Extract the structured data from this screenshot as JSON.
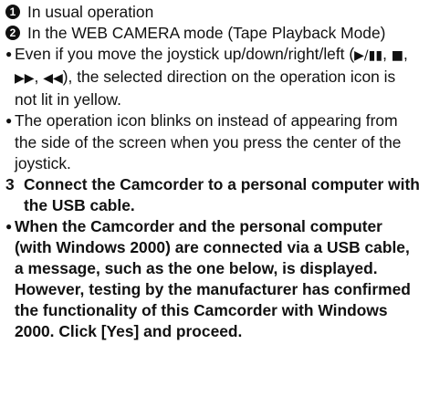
{
  "items": {
    "item1": {
      "marker": "1",
      "text": "In usual operation"
    },
    "item2": {
      "marker": "2",
      "text": "In the WEB CAMERA mode (Tape Playback Mode)"
    }
  },
  "bullets": {
    "b1": {
      "marker": "●",
      "text_a": "Even if you move the joystick up/down/right/left (",
      "sym_play": "▶/▮▮",
      "sep1": ", ",
      "sym_stop": "■",
      "sep2": ", ",
      "sym_ff": "▶▶",
      "sep3": ", ",
      "sym_rew": "◀◀",
      "text_b": "), the selected direction on the operation icon is not lit in yellow."
    },
    "b2": {
      "marker": "●",
      "text": "The operation icon blinks on instead of appearing from the side of the screen when you press the center of the joystick."
    }
  },
  "step3": {
    "number": "3",
    "text": "Connect the Camcorder to a personal computer with the USB cable."
  },
  "b3": {
    "marker": "●",
    "text": "When the Camcorder and the personal computer (with Windows 2000) are connected via a USB cable, a message, such as the one below, is displayed. However, testing by the manufacturer has confirmed the functionality of this Camcorder with Windows 2000. Click [Yes] and proceed."
  }
}
